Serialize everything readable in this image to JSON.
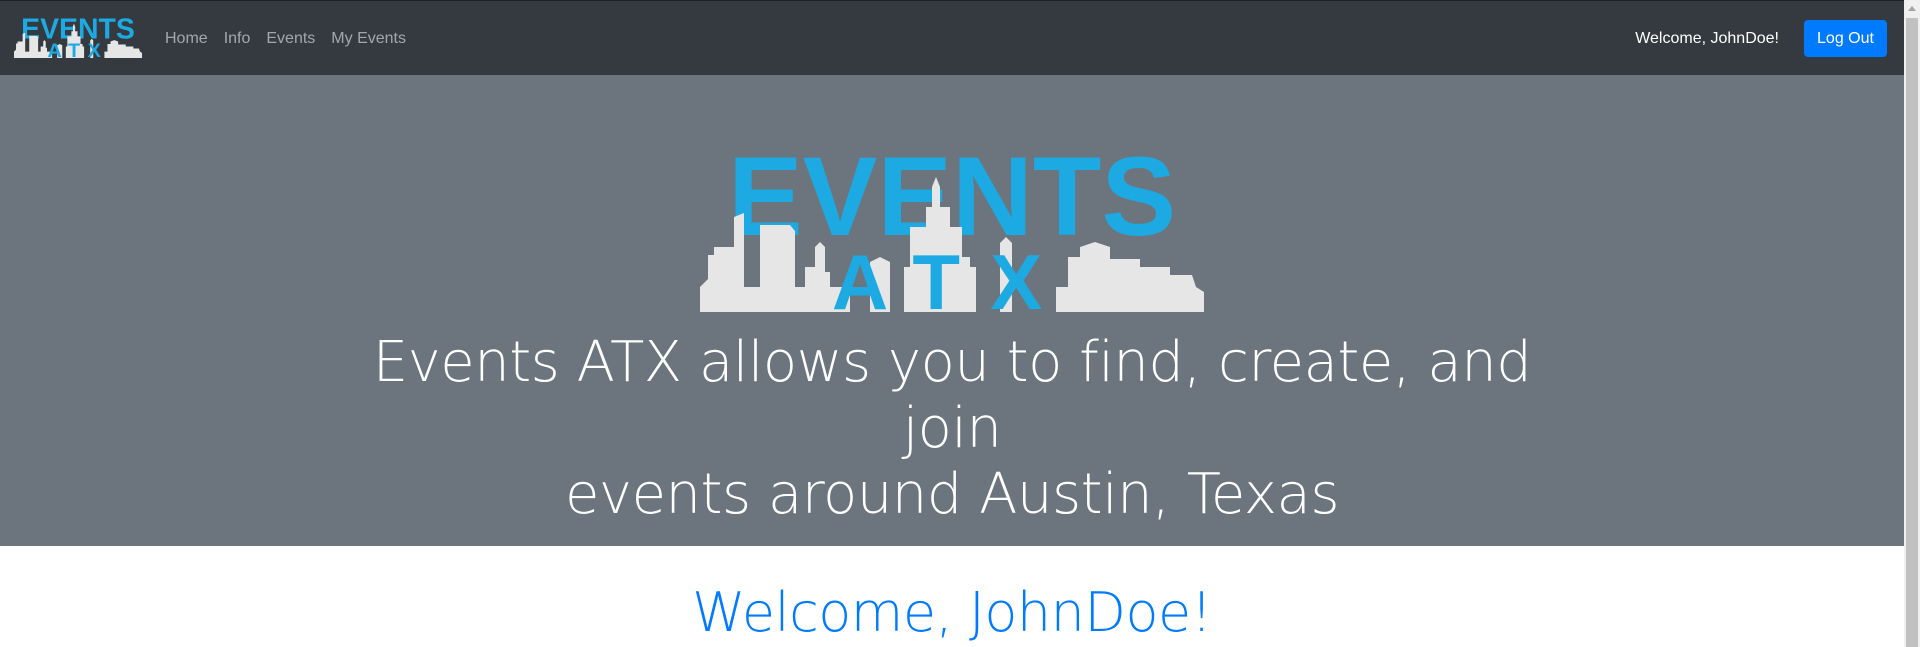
{
  "brand": {
    "logo_top": "EVENTS",
    "logo_bottom": "ATX",
    "logo_color": "#1da9e1",
    "skyline_color": "#e6e6e6"
  },
  "navbar": {
    "links": [
      "Home",
      "Info",
      "Events",
      "My Events"
    ],
    "welcome_text": "Welcome, JohnDoe!",
    "logout_label": "Log Out"
  },
  "hero": {
    "tagline_line1": "Events ATX allows you to find, create, and join",
    "tagline_line2": "events around Austin, Texas"
  },
  "main": {
    "welcome_heading": "Welcome, JohnDoe!"
  },
  "colors": {
    "navbar_bg": "#343a40",
    "hero_bg": "#6c757d",
    "accent": "#007bff"
  }
}
